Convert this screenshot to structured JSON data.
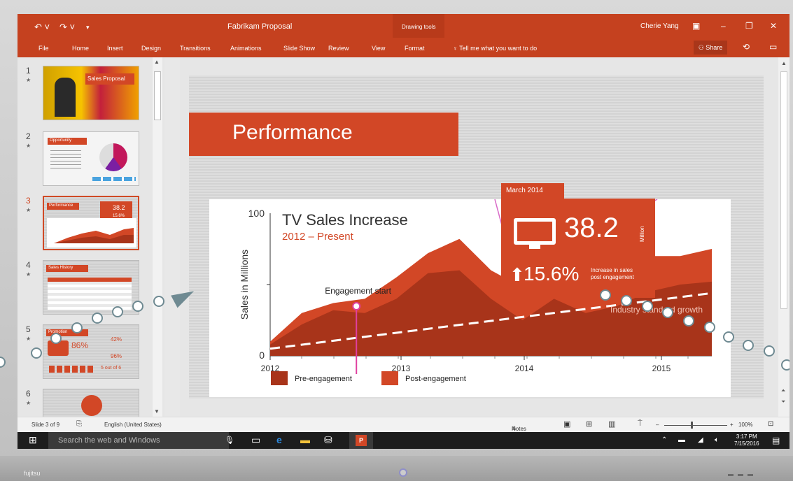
{
  "window": {
    "title": "Fabrikam Proposal",
    "context_group": "Drawing tools",
    "user": "Cherie Yang",
    "share_label": "Share",
    "tellme": "Tell me what you want to do"
  },
  "ribbon_tabs": [
    "File",
    "Home",
    "Insert",
    "Design",
    "Transitions",
    "Animations",
    "Slide Show",
    "Review",
    "View",
    "Format"
  ],
  "thumbnails": [
    {
      "num": "1",
      "title": "Sales Proposal"
    },
    {
      "num": "2",
      "title": "Opportunity"
    },
    {
      "num": "3",
      "title": "Performance"
    },
    {
      "num": "4",
      "title": "Sales History"
    },
    {
      "num": "5",
      "title": "Promotion"
    },
    {
      "num": "6",
      "title": ""
    }
  ],
  "thumb_texts": {
    "t3_num": "38.2",
    "t3_pct": "15.6%",
    "t5_pct1": "86%",
    "t5_pct2": "42%",
    "t5_pct3": "96%",
    "t5_frac": "5 out of 6"
  },
  "slide": {
    "title": "Performance",
    "card_tab": "March 2014",
    "card_value": "38.2",
    "card_unit": "Million",
    "card_pct": "15.6%",
    "card_pct_desc_1": "Increase in sales",
    "card_pct_desc_2": "post engagement",
    "chart_title": "TV Sales Increase",
    "chart_subtitle": "2012 – Present",
    "annotation": "Engagement start",
    "trend_label": "Industry standard growth"
  },
  "chart_data": {
    "type": "area",
    "title": "TV Sales Increase",
    "subtitle": "2012 – Present",
    "ylabel": "Sales in Millions",
    "ylim": [
      0,
      100
    ],
    "yticks": [
      "0",
      "100"
    ],
    "xticks": [
      "2012",
      "2013",
      "2014",
      "2015"
    ],
    "legend": [
      "Pre-engagement",
      "Post-engagement"
    ],
    "series": [
      {
        "name": "Post-engagement",
        "values": [
          10,
          30,
          37,
          40,
          55,
          72,
          82,
          60,
          48,
          55,
          45,
          58,
          70,
          70,
          75
        ]
      },
      {
        "name": "Pre-engagement",
        "values": [
          8,
          22,
          32,
          30,
          40,
          58,
          60,
          40,
          25,
          40,
          30,
          35,
          45,
          50,
          52
        ]
      }
    ],
    "trend": [
      5,
      44
    ]
  },
  "status": {
    "slide_of": "Slide 3 of 9",
    "language": "English (United States)",
    "notes": "Notes",
    "zoom": "100%"
  },
  "taskbar": {
    "search": "Search the web and Windows",
    "time": "3:17 PM",
    "date": "7/15/2016"
  },
  "device": {
    "brand": "fujitsu"
  },
  "colors": {
    "accent": "#c5411f",
    "slide_red": "#d24726",
    "dark_red": "#a8341a"
  }
}
